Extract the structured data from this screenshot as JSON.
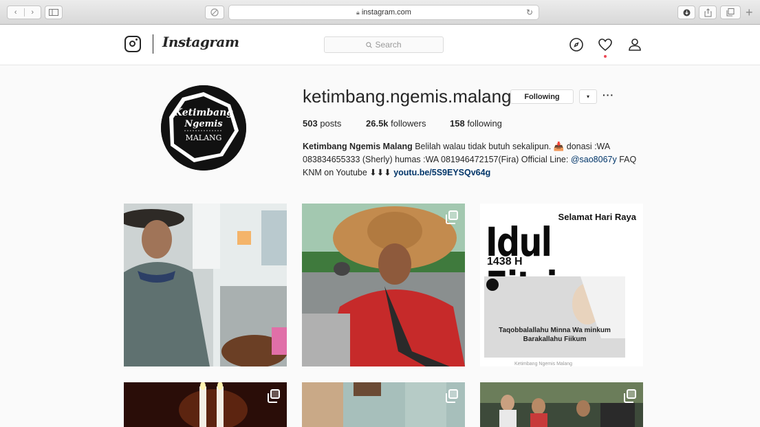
{
  "browser": {
    "url": "instagram.com",
    "icons": [
      "back-icon",
      "forward-icon",
      "sidebar-icon",
      "shield-icon",
      "lock-icon",
      "reload-icon",
      "download-icon",
      "share-icon",
      "tabs-icon",
      "new-tab-icon"
    ]
  },
  "header": {
    "wordmark": "Instagram",
    "search_placeholder": "Search",
    "icons": [
      "instagram-camera-icon",
      "compass-icon",
      "heart-icon",
      "person-icon"
    ],
    "notification_color": "#ed4956"
  },
  "profile": {
    "username": "ketimbang.ngemis.malang",
    "following_button": "Following",
    "dropdown_button": "▾",
    "more_button": "···",
    "avatar_text": {
      "line1": "Ketimbang",
      "line2": "Ngemis",
      "line3": "MALANG"
    },
    "stats": [
      {
        "value": "503",
        "label": " posts"
      },
      {
        "value": "26.5k",
        "label": " followers"
      },
      {
        "value": "158",
        "label": " following"
      }
    ],
    "bio_name": "Ketimbang Ngemis Malang",
    "bio_text1": " Belilah walau tidak butuh sekalipun. 📥 donasi :WA 083834655333 (Sherly) humas :WA 081946472157(Fira) Official Line: ",
    "bio_mention": "@sao8067y",
    "bio_text2": " FAQ KNM on Youtube ⬇⬇⬇ ",
    "bio_link": "youtu.be/5S9EYSQv64g",
    "link_color": "#003569"
  },
  "posts": {
    "flyer": {
      "top": "Selamat Hari Raya",
      "big": "Idul Fitri",
      "year": "1438 H",
      "line1": "Taqobbalallahu Minna Wa minkum",
      "line2": "Barakallahu Fiikum",
      "footer": "Ketimbang Ngemis Malang"
    },
    "multi_icon": "multiple-photos-icon"
  }
}
